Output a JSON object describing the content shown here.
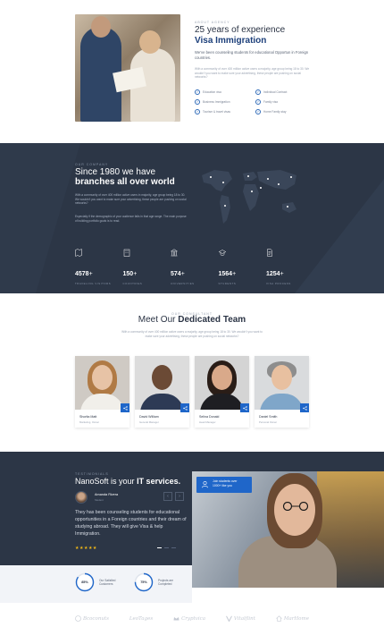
{
  "about": {
    "eyebrow": "About Agency",
    "title_light": "25 years of experience",
    "title_bold": "Visa Immigration",
    "lead": "We've been counseling students for educational Opportun in Foreign countries.",
    "body": "With a community of over 400 million active users a majority, age group being 18 to 30. We wouldn't you want to make sure your advertising, these people are pushing on social networks?",
    "features": [
      {
        "icon": "check-circle-icon",
        "label": "Education visa"
      },
      {
        "icon": "check-circle-icon",
        "label": "Individual Contract"
      },
      {
        "icon": "check-circle-icon",
        "label": "Business Immigration"
      },
      {
        "icon": "check-circle-icon",
        "label": "Family visa"
      },
      {
        "icon": "check-circle-icon",
        "label": "Tourism & travel visas"
      },
      {
        "icon": "check-circle-icon",
        "label": "Home Family stay"
      }
    ]
  },
  "history": {
    "eyebrow": "Our Company",
    "title_light": "Since 1980 we have",
    "title_bold": "branches all over world",
    "para1": "With a community of over 400 million active users in majority, age group being 18 to 30. We wouldn't you want to make sure your advertising, these people are pushing on social networks?",
    "para2": "Especially if the demographic of your audience falls in that age range. The main purpose of building portfolio goals is to read.",
    "stats": [
      {
        "icon": "map-icon",
        "value": "4578",
        "label": "Traveling Visitors"
      },
      {
        "icon": "building-icon",
        "value": "150",
        "label": "Countries"
      },
      {
        "icon": "bank-icon",
        "value": "574",
        "label": "Universities"
      },
      {
        "icon": "graduation-icon",
        "value": "1564",
        "label": "Students"
      },
      {
        "icon": "document-icon",
        "value": "1254",
        "label": "Visa Process"
      }
    ]
  },
  "team": {
    "eyebrow": "Our Consultant",
    "title_light": "Meet Our",
    "title_bold": "Dedicated Team",
    "lead": "With a community of over 400 million active users a majority, age group being 18 to 30. We wouldn't you want to make sure your advertising, these people are pushing on social networks?",
    "members": [
      {
        "name": "Shorita Matt",
        "role": "Marketing, Owner"
      },
      {
        "name": "David William",
        "role": "General Manager"
      },
      {
        "name": "Selina Donald",
        "role": "Head Manager"
      },
      {
        "name": "Daniel Smith",
        "role": "Personal Owner"
      }
    ]
  },
  "testimonial": {
    "eyebrow": "Testimonials",
    "title_light": "NanoSoft is your",
    "title_bold": "IT services.",
    "name": "Amanda Rivera",
    "role": "Student",
    "quote": "They has been counseling students for educational opportunities in a Foreign countries and their dream of studying abroad. They will give Visa & help Immigration.",
    "stars": "★★★★★",
    "promo_line1": "Join students over",
    "promo_line2": "1000+ like you"
  },
  "progress": [
    {
      "value": "85%",
      "label": "Our Satisfied Customers",
      "fraction": 0.85
    },
    {
      "value": "75%",
      "label": "Projects are Completed",
      "fraction": 0.75
    }
  ],
  "logos": [
    {
      "name": "Bcoconuts"
    },
    {
      "name": "LeoTages"
    },
    {
      "name": "Cryptvica"
    },
    {
      "name": "Vitalflint"
    },
    {
      "name": "MarHome"
    }
  ],
  "colors": {
    "primary": "#1f66c9",
    "dark_bg": "#2c3646",
    "heading_blue": "#1c3f7a",
    "star": "#f1b716"
  }
}
